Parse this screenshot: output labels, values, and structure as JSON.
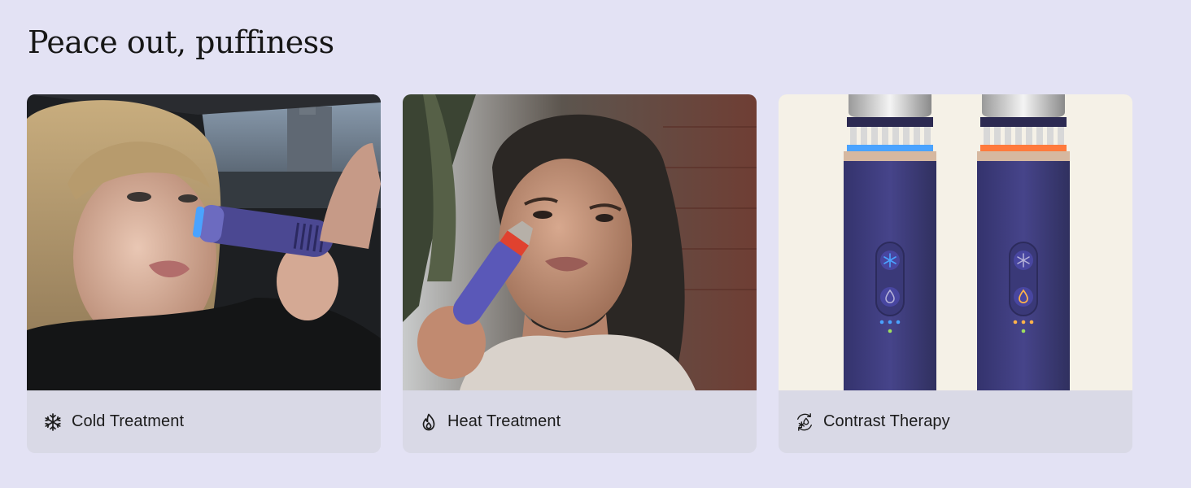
{
  "heading": "Peace out, puffiness",
  "cards": [
    {
      "label": "Cold Treatment",
      "icon": "snowflake-icon"
    },
    {
      "label": "Heat Treatment",
      "icon": "flame-icon"
    },
    {
      "label": "Contrast Therapy",
      "icon": "hot-cold-cycle-icon"
    }
  ],
  "colors": {
    "page_background": "#e3e2f4",
    "caption_background": "#d9d9e6",
    "device_purple": "#3f3d7e",
    "cold_light": "#4aa3ff",
    "heat_light": "#ff7a3d"
  }
}
